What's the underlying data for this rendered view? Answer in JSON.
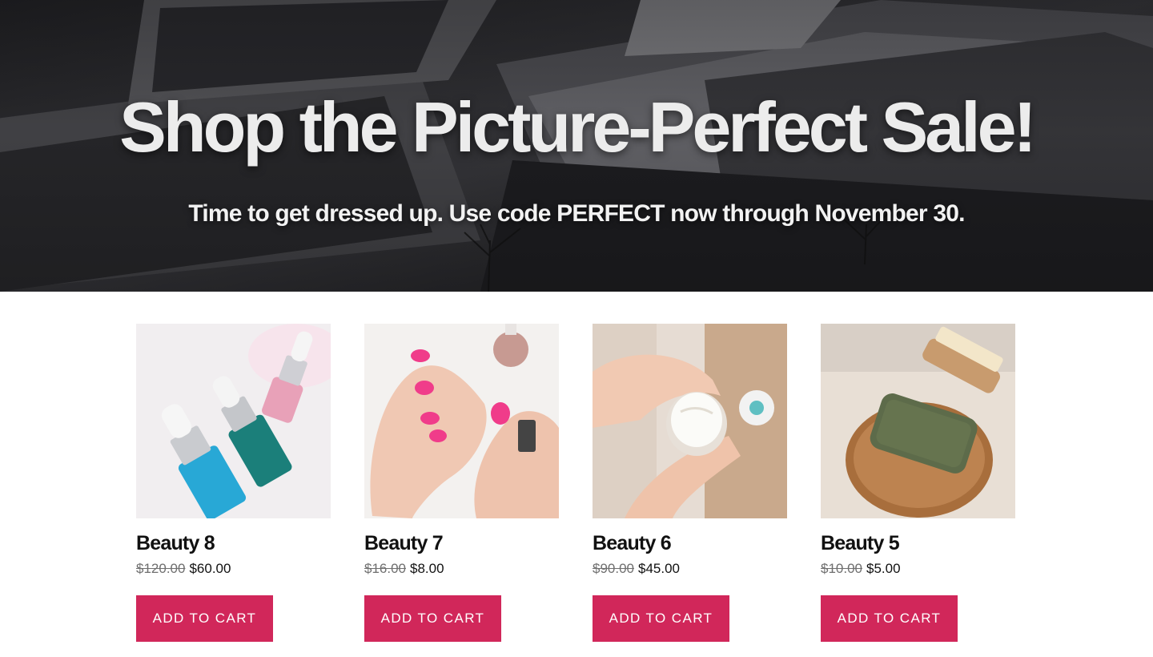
{
  "hero": {
    "title": "Shop the Picture-Perfect Sale!",
    "subtitle": "Time to get dressed up. Use code PERFECT now through November 30."
  },
  "products": [
    {
      "title": "Beauty 8",
      "price_old": "$120.00",
      "price_new": "$60.00",
      "button_label": "ADD TO CART"
    },
    {
      "title": "Beauty 7",
      "price_old": "$16.00",
      "price_new": "$8.00",
      "button_label": "ADD TO CART"
    },
    {
      "title": "Beauty 6",
      "price_old": "$90.00",
      "price_new": "$45.00",
      "button_label": "ADD TO CART"
    },
    {
      "title": "Beauty 5",
      "price_old": "$10.00",
      "price_new": "$5.00",
      "button_label": "ADD TO CART"
    }
  ],
  "colors": {
    "accent": "#d1275a",
    "hero_bg": "#1a1a1c"
  }
}
